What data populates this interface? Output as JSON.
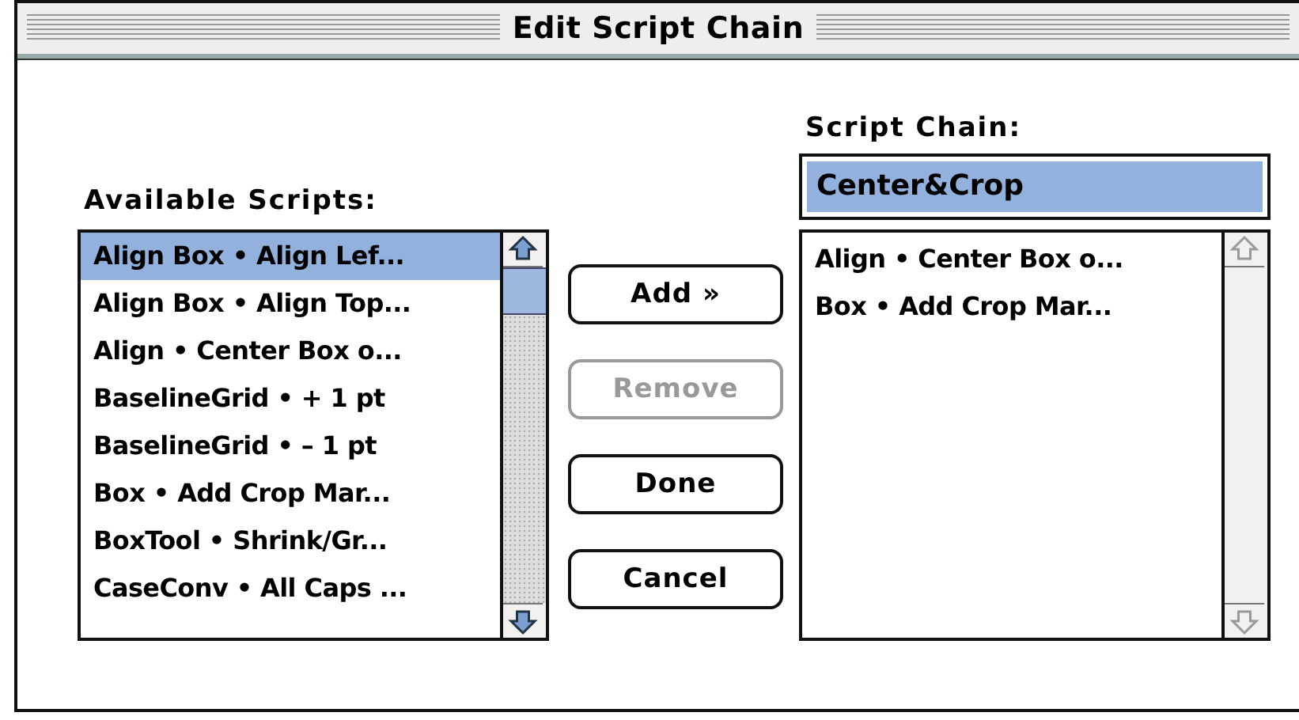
{
  "window": {
    "title": "Edit Script Chain"
  },
  "available": {
    "label": "Available Scripts:",
    "scrollable": true,
    "items": [
      {
        "text": "Align Box • Align Lef...",
        "selected": true
      },
      {
        "text": "Align Box • Align Top...",
        "selected": false
      },
      {
        "text": "Align • Center Box o...",
        "selected": false
      },
      {
        "text": "BaselineGrid • + 1 pt",
        "selected": false
      },
      {
        "text": "BaselineGrid • – 1 pt",
        "selected": false
      },
      {
        "text": "Box • Add Crop Mar...",
        "selected": false
      },
      {
        "text": "BoxTool • Shrink/Gr...",
        "selected": false
      },
      {
        "text": "CaseConv • All Caps ...",
        "selected": false
      }
    ]
  },
  "buttons": [
    {
      "label": "Add »",
      "disabled": false
    },
    {
      "label": "Remove",
      "disabled": true
    },
    {
      "label": "Done",
      "disabled": false
    },
    {
      "label": "Cancel",
      "disabled": false
    }
  ],
  "chain": {
    "label": "Script Chain:",
    "name_field": {
      "value": "Center&Crop",
      "selected": true
    },
    "scrollable": false,
    "items": [
      {
        "text": "Align • Center Box o...",
        "selected": false
      },
      {
        "text": "Box • Add Crop Mar...",
        "selected": false
      }
    ]
  }
}
